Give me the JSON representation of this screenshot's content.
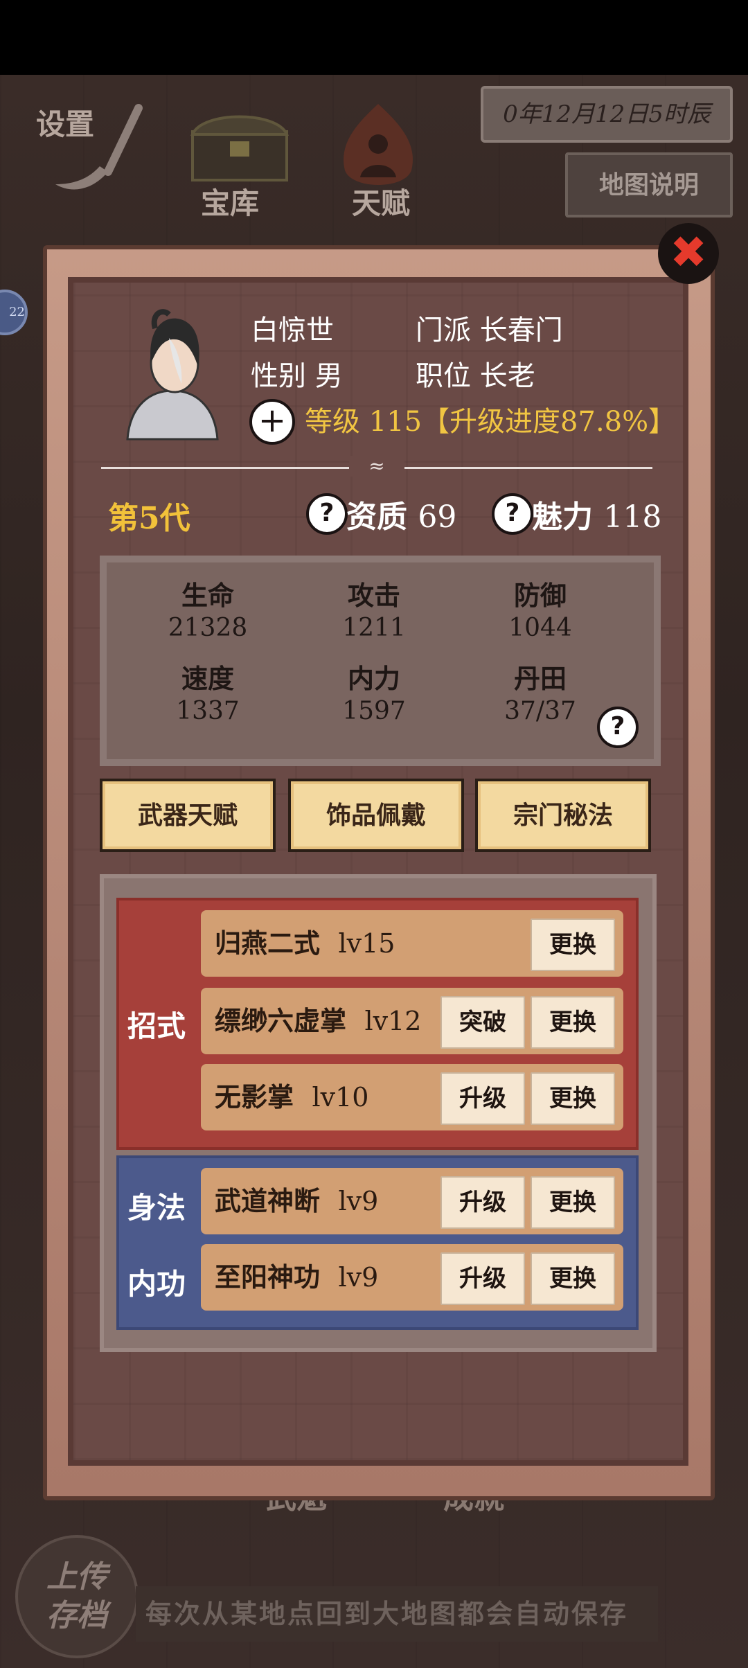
{
  "top_bar": {
    "settings": "设置",
    "treasury": "宝库",
    "talent": "天赋",
    "date": "0年12月12日5时辰",
    "map_help": "地图说明"
  },
  "side_badge": "22",
  "character": {
    "name": "白惊世",
    "sect_label": "门派",
    "sect": "长春门",
    "gender_label": "性别",
    "gender": "男",
    "position_label": "职位",
    "position": "长老",
    "level_text": "等级 115【升级进度87.8%】",
    "generation": "第5代",
    "aptitude_label": "资质",
    "aptitude": "69",
    "charm_label": "魅力",
    "charm": "118"
  },
  "stats": [
    {
      "label": "生命",
      "value": "21328"
    },
    {
      "label": "攻击",
      "value": "1211"
    },
    {
      "label": "防御",
      "value": "1044"
    },
    {
      "label": "速度",
      "value": "1337"
    },
    {
      "label": "内力",
      "value": "1597"
    },
    {
      "label": "丹田",
      "value": "37/37"
    }
  ],
  "tabs": [
    "武器天赋",
    "饰品佩戴",
    "宗门秘法"
  ],
  "categories": {
    "moves": "招式",
    "movement": "身法",
    "internal": "内功"
  },
  "skills": [
    {
      "name": "归燕二式",
      "level": "lv15",
      "action": "",
      "replace": "更换"
    },
    {
      "name": "缥缈六虚掌",
      "level": "lv12",
      "action": "突破",
      "replace": "更换"
    },
    {
      "name": "无影掌",
      "level": "lv10",
      "action": "升级",
      "replace": "更换"
    },
    {
      "name": "武道神断",
      "level": "lv9",
      "action": "升级",
      "replace": "更换"
    },
    {
      "name": "至阳神功",
      "level": "lv9",
      "action": "升级",
      "replace": "更换"
    }
  ],
  "bottom": {
    "wukui": "武魁",
    "achievements": "成就",
    "upload_line1": "上传",
    "upload_line2": "存档",
    "autosave_note": "每次从某地点回到大地图都会自动保存"
  },
  "colors": {
    "gold": "#f2c23a",
    "panel_frame": "#c69a87",
    "moves_block": "#a6403a",
    "internal_block": "#4c5a8c",
    "close_red": "#e53a2c"
  },
  "icons": [
    "brush-icon",
    "treasure-chest-icon",
    "flame-meditation-icon",
    "close-icon",
    "plus-icon",
    "question-icon"
  ]
}
